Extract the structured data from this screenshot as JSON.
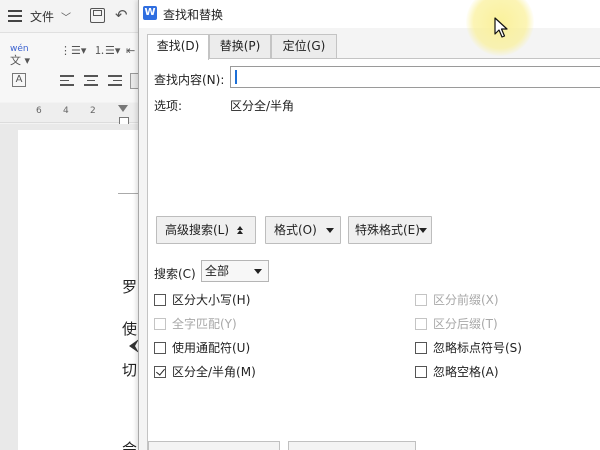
{
  "background_app": {
    "file_menu_label": "文件",
    "ruler_numbers": [
      "6",
      "4",
      "2"
    ],
    "doc_chars": [
      "罗",
      "使",
      "切",
      "会"
    ]
  },
  "dialog": {
    "app_icon_letter": "W",
    "title": "查找和替换",
    "tabs": [
      {
        "label": "查找(D)",
        "active": true
      },
      {
        "label": "替换(P)",
        "active": false
      },
      {
        "label": "定位(G)",
        "active": false
      }
    ],
    "find": {
      "label": "查找内容(N):",
      "value": ""
    },
    "options": {
      "label": "选项:",
      "value": "区分全/半角"
    },
    "buttons": {
      "advanced_search": "高级搜索(L)",
      "format": "格式(O)",
      "special_format": "特殊格式(E)"
    },
    "search": {
      "label": "搜索(C)",
      "selected": "全部"
    },
    "checkboxes": {
      "match_case": {
        "label": "区分大小写(H)",
        "checked": false,
        "enabled": true
      },
      "whole_word": {
        "label": "全字匹配(Y)",
        "checked": false,
        "enabled": false
      },
      "wildcards": {
        "label": "使用通配符(U)",
        "checked": false,
        "enabled": true
      },
      "match_width": {
        "label": "区分全/半角(M)",
        "checked": true,
        "enabled": true
      },
      "match_prefix": {
        "label": "区分前缀(X)",
        "checked": false,
        "enabled": false
      },
      "match_suffix": {
        "label": "区分后缀(T)",
        "checked": false,
        "enabled": false
      },
      "ignore_punct": {
        "label": "忽略标点符号(S)",
        "checked": false,
        "enabled": true
      },
      "ignore_space": {
        "label": "忽略空格(A)",
        "checked": false,
        "enabled": true
      }
    }
  },
  "colors": {
    "accent_blue": "#2f6ee0",
    "cursor_highlight": "#faf096"
  }
}
